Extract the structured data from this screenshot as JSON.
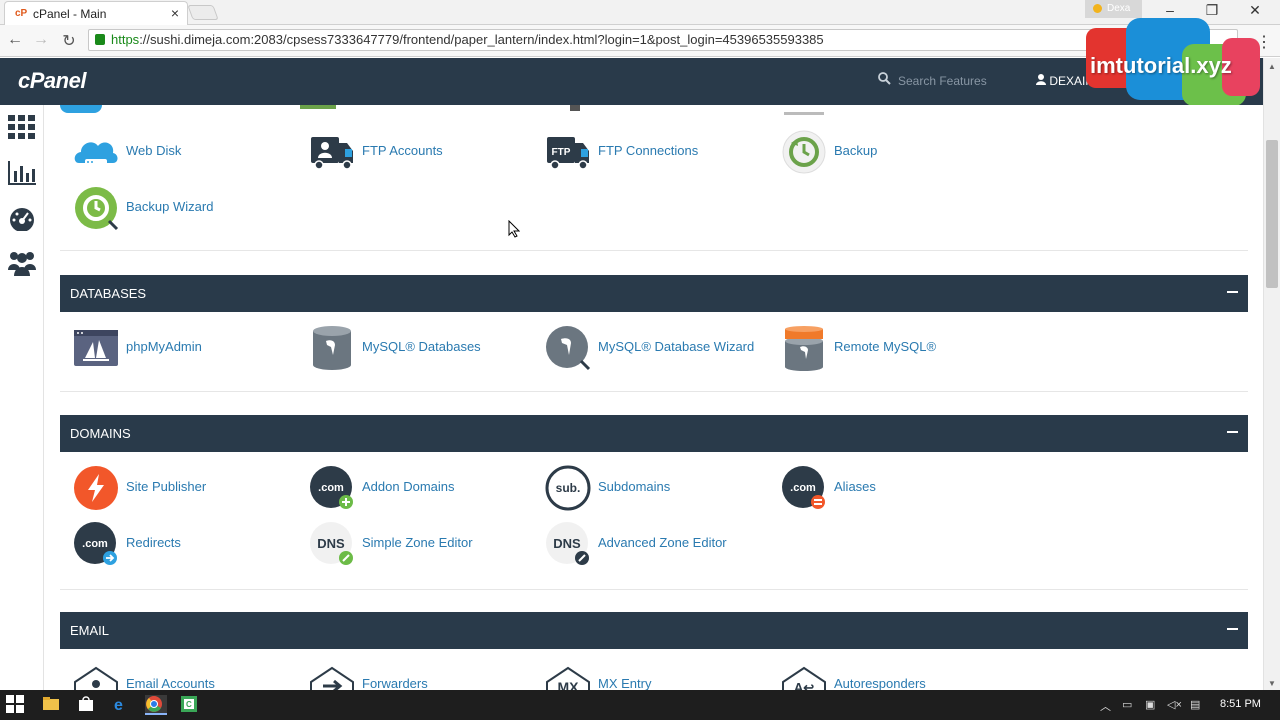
{
  "browser": {
    "tab_title": "cPanel - Main",
    "profile_name": "Dexa",
    "url_scheme": "https",
    "url_rest": "://sushi.dimeja.com:2083/cpsess7333647779/frontend/paper_lantern/index.html?login=1&post_login=45396535593385"
  },
  "header": {
    "logo": "cPanel",
    "search_placeholder": "Search Features",
    "user_label": "DEXAINDO"
  },
  "watermark": "imtutorial.xyz",
  "files_section": {
    "items": [
      {
        "label": "Web Disk",
        "icon": "web-disk-icon"
      },
      {
        "label": "FTP Accounts",
        "icon": "ftp-accounts-icon"
      },
      {
        "label": "FTP Connections",
        "icon": "ftp-connections-icon"
      },
      {
        "label": "Backup",
        "icon": "backup-icon"
      },
      {
        "label": "Backup Wizard",
        "icon": "backup-wizard-icon"
      }
    ]
  },
  "databases": {
    "title": "DATABASES",
    "items": [
      {
        "label": "phpMyAdmin",
        "icon": "phpmyadmin-icon"
      },
      {
        "label": "MySQL® Databases",
        "icon": "mysql-databases-icon"
      },
      {
        "label": "MySQL® Database Wizard",
        "icon": "mysql-wizard-icon"
      },
      {
        "label": "Remote MySQL®",
        "icon": "remote-mysql-icon"
      }
    ]
  },
  "domains": {
    "title": "DOMAINS",
    "items": [
      {
        "label": "Site Publisher",
        "icon": "site-publisher-icon"
      },
      {
        "label": "Addon Domains",
        "icon": "addon-domains-icon"
      },
      {
        "label": "Subdomains",
        "icon": "subdomains-icon"
      },
      {
        "label": "Aliases",
        "icon": "aliases-icon"
      },
      {
        "label": "Redirects",
        "icon": "redirects-icon"
      },
      {
        "label": "Simple Zone Editor",
        "icon": "simple-zone-editor-icon"
      },
      {
        "label": "Advanced Zone Editor",
        "icon": "advanced-zone-editor-icon"
      }
    ]
  },
  "email": {
    "title": "EMAIL",
    "items": [
      {
        "label": "Email Accounts",
        "icon": "email-accounts-icon"
      },
      {
        "label": "Forwarders",
        "icon": "forwarders-icon"
      },
      {
        "label": "MX Entry",
        "icon": "mx-entry-icon"
      },
      {
        "label": "Autoresponders",
        "icon": "autoresponders-icon"
      }
    ]
  },
  "icon_text": {
    "ftp": "FTP",
    "com": ".com",
    "sub": "sub.",
    "dns": "DNS",
    "mx": "MX",
    "auto": "A↩"
  },
  "taskbar": {
    "time": "8:51 PM"
  },
  "colors": {
    "header_bg": "#293a4a",
    "link": "#2a7ab0",
    "ssl_green": "#1a8a1a"
  }
}
